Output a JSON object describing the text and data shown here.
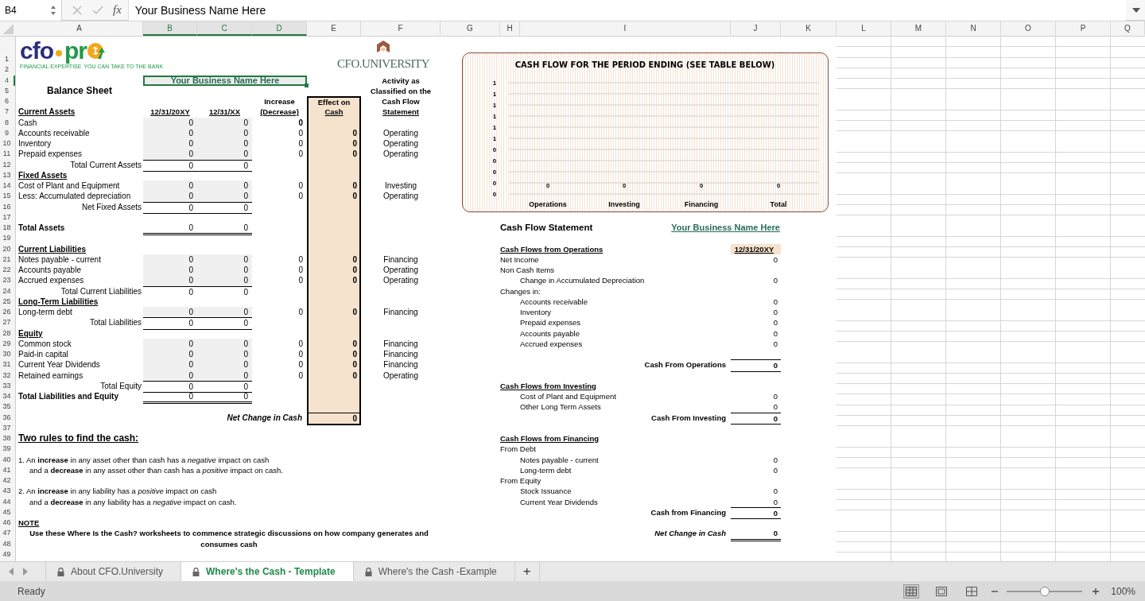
{
  "formula_bar": {
    "name_box": "B4",
    "function_label": "fx",
    "formula": "Your Business Name Here"
  },
  "columns": [
    {
      "label": "A",
      "selected": false
    },
    {
      "label": "B",
      "selected": true
    },
    {
      "label": "C",
      "selected": true
    },
    {
      "label": "D",
      "selected": true
    },
    {
      "label": "E",
      "selected": false
    },
    {
      "label": "F",
      "selected": false
    },
    {
      "label": "G",
      "selected": false
    },
    {
      "label": "H",
      "selected": false
    },
    {
      "label": "I",
      "selected": false
    },
    {
      "label": "J",
      "selected": false
    },
    {
      "label": "K",
      "selected": false
    },
    {
      "label": "L",
      "selected": false
    },
    {
      "label": "M",
      "selected": false
    },
    {
      "label": "N",
      "selected": false
    },
    {
      "label": "O",
      "selected": false
    },
    {
      "label": "P",
      "selected": false
    },
    {
      "label": "Q",
      "selected": false
    }
  ],
  "row_numbers": [
    {
      "label": "1",
      "selected": false
    },
    {
      "label": "2",
      "selected": false
    },
    {
      "label": "4",
      "selected": true
    },
    {
      "label": "5",
      "selected": false
    },
    {
      "label": "6",
      "selected": false
    },
    {
      "label": "7",
      "selected": false
    },
    {
      "label": "8",
      "selected": false
    },
    {
      "label": "9",
      "selected": false
    },
    {
      "label": "10",
      "selected": false
    },
    {
      "label": "11",
      "selected": false
    },
    {
      "label": "12",
      "selected": false
    },
    {
      "label": "13",
      "selected": false
    },
    {
      "label": "14",
      "selected": false
    },
    {
      "label": "15",
      "selected": false
    },
    {
      "label": "16",
      "selected": false
    },
    {
      "label": "17",
      "selected": false
    },
    {
      "label": "18",
      "selected": false
    },
    {
      "label": "19",
      "selected": false
    },
    {
      "label": "20",
      "selected": false
    },
    {
      "label": "21",
      "selected": false
    },
    {
      "label": "22",
      "selected": false
    },
    {
      "label": "23",
      "selected": false
    },
    {
      "label": "24",
      "selected": false
    },
    {
      "label": "25",
      "selected": false
    },
    {
      "label": "26",
      "selected": false
    },
    {
      "label": "27",
      "selected": false
    },
    {
      "label": "28",
      "selected": false
    },
    {
      "label": "29",
      "selected": false
    },
    {
      "label": "30",
      "selected": false
    },
    {
      "label": "31",
      "selected": false
    },
    {
      "label": "32",
      "selected": false
    },
    {
      "label": "33",
      "selected": false
    },
    {
      "label": "34",
      "selected": false
    },
    {
      "label": "35",
      "selected": false
    },
    {
      "label": "36",
      "selected": false
    },
    {
      "label": "37",
      "selected": false
    },
    {
      "label": "38",
      "selected": false
    },
    {
      "label": "39",
      "selected": false
    },
    {
      "label": "40",
      "selected": false
    },
    {
      "label": "41",
      "selected": false
    },
    {
      "label": "42",
      "selected": false
    },
    {
      "label": "43",
      "selected": false
    },
    {
      "label": "44",
      "selected": false
    },
    {
      "label": "45",
      "selected": false
    },
    {
      "label": "46",
      "selected": false
    },
    {
      "label": "47",
      "selected": false
    },
    {
      "label": "48",
      "selected": false
    },
    {
      "label": "49",
      "selected": false
    }
  ],
  "logos": {
    "cfo_pro": {
      "word_a": "cfo",
      "word_b": "pr",
      "tagline_a": "FINANCIAL EXPERTISE",
      "tagline_b": "YOU CAN TAKE TO THE BANK"
    },
    "cfo_university": "CFO.UNIVERSITY"
  },
  "balance_sheet": {
    "title": "Balance Sheet",
    "business_name": {
      "text": "Your Business Name Here",
      "selected": true
    },
    "headers": {
      "a": "Current Assets",
      "b": "12/31/20XY",
      "c": "12/31/XX",
      "d": [
        "Increase",
        "(Decrease)"
      ],
      "e": [
        "Effect on",
        "Cash"
      ],
      "f": [
        "Activity as",
        "Classified on the",
        "Cash Flow",
        "Statement"
      ]
    },
    "rows": [
      {
        "kind": "item",
        "label": "Cash",
        "b": "0",
        "c": "0",
        "d": "0",
        "d_bold": true
      },
      {
        "kind": "item",
        "label": "Accounts receivable",
        "b": "0",
        "c": "0",
        "d": "0",
        "d_bold": false,
        "e": "0",
        "f": "Operating"
      },
      {
        "kind": "item",
        "label": "Inventory",
        "b": "0",
        "c": "0",
        "d": "0",
        "d_bold": false,
        "e": "0",
        "f": "Operating"
      },
      {
        "kind": "item",
        "label": "Prepaid expenses",
        "b": "0",
        "c": "0",
        "d": "0",
        "d_bold": false,
        "e": "0",
        "f": "Operating"
      },
      {
        "kind": "total",
        "label": "Total Current Assets",
        "b": "0",
        "c": "0",
        "ruled": true
      },
      {
        "kind": "section",
        "label": "Fixed Assets"
      },
      {
        "kind": "item",
        "label": "Cost of Plant and Equipment",
        "b": "0",
        "c": "0",
        "d": "0",
        "d_bold": false,
        "e": "0",
        "f": "Investing"
      },
      {
        "kind": "item",
        "label": "Less: Accumulated depreciation",
        "b": "0",
        "c": "0",
        "d": "0",
        "d_bold": false,
        "e": "0",
        "f": "Operating"
      },
      {
        "kind": "total",
        "label": "Net Fixed Assets",
        "b": "0",
        "c": "0",
        "ruled": true
      },
      {
        "kind": "blank"
      },
      {
        "kind": "grand",
        "label": "Total Assets",
        "b": "0",
        "c": "0"
      },
      {
        "kind": "blank"
      },
      {
        "kind": "section",
        "label": "Current Liabilities"
      },
      {
        "kind": "item",
        "label": "Notes payable - current",
        "b": "0",
        "c": "0",
        "d": "0",
        "d_bold": false,
        "e": "0",
        "f": "Financing"
      },
      {
        "kind": "item",
        "label": "Accounts payable",
        "b": "0",
        "c": "0",
        "d": "0",
        "d_bold": false,
        "e": "0",
        "f": "Operating"
      },
      {
        "kind": "item",
        "label": "Accrued expenses",
        "b": "0",
        "c": "0",
        "d": "0",
        "d_bold": false,
        "e": "0",
        "f": "Operating"
      },
      {
        "kind": "total",
        "label": "Total Current Liabilities",
        "b": "0",
        "c": "0",
        "ruled": false
      },
      {
        "kind": "section",
        "label": "Long-Term Liabilities"
      },
      {
        "kind": "item",
        "label": "Long-term debt",
        "b": "0",
        "c": "0",
        "d": "0",
        "d_bold": false,
        "e": "0",
        "f": "Financing"
      },
      {
        "kind": "total",
        "label": "Total Liabilities",
        "b": "0",
        "c": "0",
        "ruled": true
      },
      {
        "kind": "section",
        "label": "Equity"
      },
      {
        "kind": "item",
        "label": "Common stock",
        "b": "0",
        "c": "0",
        "d": "0",
        "d_bold": false,
        "e": "0",
        "f": "Financing"
      },
      {
        "kind": "item",
        "label": "Paid-in capital",
        "b": "0",
        "c": "0",
        "d": "0",
        "d_bold": false,
        "e": "0",
        "f": "Financing"
      },
      {
        "kind": "item",
        "label": "Current Year Dividends",
        "b": "0",
        "c": "0",
        "d": "0",
        "d_bold": false,
        "e": "0",
        "f": "Financing"
      },
      {
        "kind": "item",
        "label": "Retained earnings",
        "b": "0",
        "c": "0",
        "d": "0",
        "d_bold": false,
        "e": "0",
        "f": "Operating"
      },
      {
        "kind": "total",
        "label": "Total Equity",
        "b": "0",
        "c": "0",
        "ruled": true
      },
      {
        "kind": "grand",
        "label": "Total Liabilities and Equity",
        "b": "0",
        "c": "0"
      },
      {
        "kind": "blank"
      },
      {
        "kind": "net",
        "label": "Net Change in Cash",
        "e": "0"
      }
    ]
  },
  "rules": {
    "title": "Two rules to find the cash:",
    "groups": [
      [
        "1. An **increase** in any asset other than cash has a *negative* impact on cash",
        "and a **decrease** in any asset other than cash has a *positive* impact on cash."
      ],
      [
        "2. An **increase** in any liability has a *positive* impact on cash",
        "and a **decrease** in any liability has a *negative* impact on cash."
      ]
    ]
  },
  "note": {
    "title": "NOTE",
    "text": "Use these Where Is the Cash? worksheets to commence strategic discussions on how company generates and consumes cash"
  },
  "chart": {
    "chart_data": {
      "type": "bar",
      "title": "CASH FLOW FOR THE PERIOD ENDING (SEE TABLE BELOW)",
      "categories": [
        "Operations",
        "Investing",
        "Financing",
        "Total"
      ],
      "values": [
        0,
        0,
        0,
        0
      ],
      "ylim": [
        0,
        1
      ],
      "yticks": [
        {
          "value": 1,
          "label": "1"
        },
        {
          "value": 0.9,
          "label": "1"
        },
        {
          "value": 0.8,
          "label": "1"
        },
        {
          "value": 0.7,
          "label": "1"
        },
        {
          "value": 0.6,
          "label": "1"
        },
        {
          "value": 0.5,
          "label": "1"
        },
        {
          "value": 0.4,
          "label": "0"
        },
        {
          "value": 0.3,
          "label": "0"
        },
        {
          "value": 0.2,
          "label": "0"
        },
        {
          "value": 0.1,
          "label": "0"
        },
        {
          "value": 0,
          "label": "0"
        }
      ],
      "data_labels": true,
      "grid": true
    }
  },
  "cash_flow": {
    "title": "Cash Flow Statement",
    "business_name": "Your Business Name Here",
    "rows": [
      {
        "kind": "blank"
      },
      {
        "kind": "section",
        "label": "Cash Flows from Operations",
        "value": "12/31/20XY"
      },
      {
        "kind": "line",
        "label": "Net Income",
        "value": "0"
      },
      {
        "kind": "line",
        "label": "Non Cash Items"
      },
      {
        "kind": "indent",
        "label": "Change in Accumulated Depreciation",
        "value": "0"
      },
      {
        "kind": "line",
        "label": "Changes in:"
      },
      {
        "kind": "indent",
        "label": "Accounts receivable",
        "value": "0"
      },
      {
        "kind": "indent",
        "label": "Inventory",
        "value": "0"
      },
      {
        "kind": "indent",
        "label": "Prepaid expenses",
        "value": "0"
      },
      {
        "kind": "indent",
        "label": "Accounts payable",
        "value": "0"
      },
      {
        "kind": "indent",
        "label": "Accrued expenses",
        "value": "0"
      },
      {
        "kind": "blank"
      },
      {
        "kind": "total",
        "label": "Cash From Operations",
        "value": "0"
      },
      {
        "kind": "blank"
      },
      {
        "kind": "section",
        "label": "Cash Flows from Investing"
      },
      {
        "kind": "indent",
        "label": "Cost of Plant and Equipment",
        "value": "0"
      },
      {
        "kind": "indent",
        "label": "Other Long Term Assets",
        "value": "0"
      },
      {
        "kind": "total",
        "label": "Cash From Investing",
        "value": "0"
      },
      {
        "kind": "blank"
      },
      {
        "kind": "section",
        "label": "Cash Flows from Financing"
      },
      {
        "kind": "line",
        "label": "From Debt"
      },
      {
        "kind": "indent",
        "label": "Notes payable - current",
        "value": "0"
      },
      {
        "kind": "indent",
        "label": "Long-term debt",
        "value": "0"
      },
      {
        "kind": "line",
        "label": "From Equity"
      },
      {
        "kind": "indent",
        "label": "Stock Issuance",
        "value": "0"
      },
      {
        "kind": "indent",
        "label": "Current Year Dividends",
        "value": "0"
      },
      {
        "kind": "total",
        "label": "Cash from Financing",
        "value": "0"
      },
      {
        "kind": "blank"
      },
      {
        "kind": "net",
        "label": "Net Change in Cash",
        "value": "0"
      }
    ]
  },
  "sheet_tabs": [
    {
      "label": "About CFO.University",
      "selected": false
    },
    {
      "label": "Where's the Cash - Template",
      "selected": true
    },
    {
      "label": "Where's the Cash -Example",
      "selected": false
    }
  ],
  "add_sheet": "+",
  "status": "Ready",
  "view_modes": [
    {
      "selected": true
    },
    {
      "selected": false
    },
    {
      "selected": false
    }
  ],
  "zoom": {
    "level": 0.5,
    "reading": "100%"
  }
}
